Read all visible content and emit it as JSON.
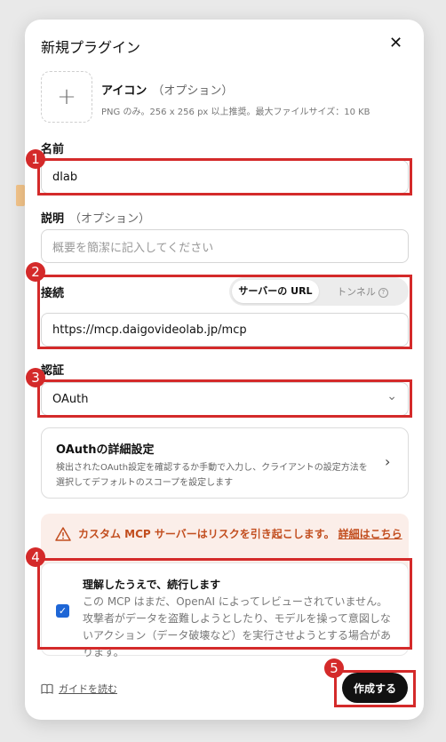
{
  "dialog": {
    "title": "新規プラグイン",
    "close": "✕"
  },
  "icon": {
    "plus": "+",
    "label": "アイコン",
    "optional": "（オプション）",
    "hint": "PNG のみ。256 x 256 px 以上推奨。最大ファイルサイズ：10 KB"
  },
  "name": {
    "label": "名前",
    "value": "dlab"
  },
  "description": {
    "label": "説明",
    "optional": "（オプション）",
    "placeholder": "概要を簡潔に記入してください"
  },
  "connection": {
    "label": "接続",
    "segments": [
      "サーバーの URL",
      "トンネル"
    ],
    "info": "?",
    "url": "https://mcp.daigovideolab.jp/mcp"
  },
  "auth": {
    "label": "認証",
    "selected": "OAuth",
    "chevron": "⌄"
  },
  "oauth_card": {
    "title": "OAuthの詳細設定",
    "desc": "検出されたOAuth設定を確認するか手動で入力し、クライアントの設定方法を選択してデフォルトのスコープを設定します",
    "chevron": "›"
  },
  "warning": {
    "text": "カスタム MCP サーバーはリスクを引き起こします。",
    "link": "詳細はこちら",
    "color": "#c24e1f"
  },
  "acknowledge": {
    "title": "理解したうえで、続行します",
    "desc": "この MCP はまだ、OpenAI によってレビューされていません。攻撃者がデータを盗難しようとしたり、モデルを操って意図しないアクション（データ破壊など）を実行させようとする場合があります。",
    "checked": "✓"
  },
  "footer": {
    "guide": "ガイドを読む",
    "create": "作成する"
  },
  "annotations": [
    "1",
    "2",
    "3",
    "4",
    "5"
  ],
  "colors": {
    "highlight": "#d42a2a",
    "checkbox": "#1e66d6",
    "primary_button": "#111111"
  }
}
